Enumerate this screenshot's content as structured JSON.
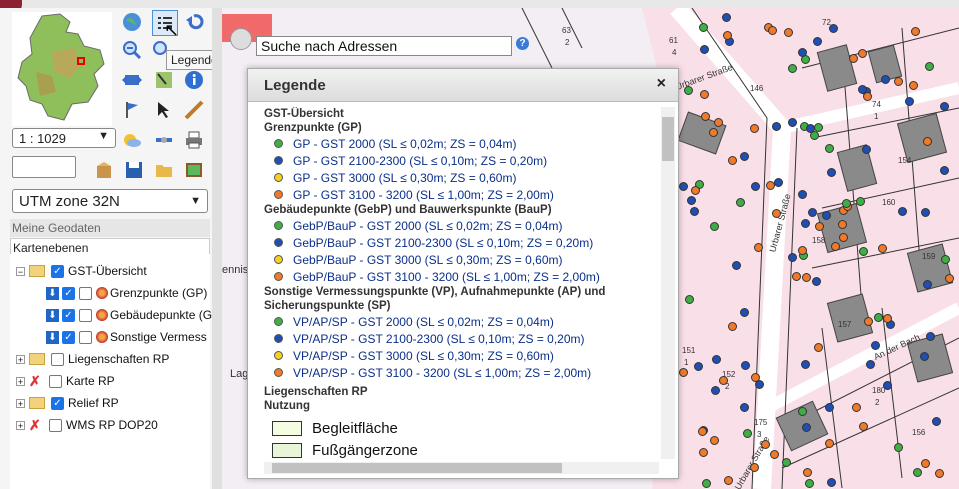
{
  "toolbar": {
    "tooltip": "Legende"
  },
  "scale": {
    "value": "1 : 1029"
  },
  "coordinate_input": {
    "value": ""
  },
  "crs": {
    "value": "UTM zone 32N"
  },
  "geodata": {
    "header": "Meine Geodaten",
    "subheader": "Kartenebenen"
  },
  "layers": [
    {
      "label": "GST-Übersicht"
    },
    {
      "label": "Grenzpunkte (GP)"
    },
    {
      "label": "Gebäudepunkte (G"
    },
    {
      "label": "Sonstige Vermess"
    },
    {
      "label": "Liegenschaften RP"
    },
    {
      "label": "Karte RP"
    },
    {
      "label": "Relief RP"
    },
    {
      "label": "WMS RP DOP20"
    }
  ],
  "search": {
    "value": "Suche nach Adressen"
  },
  "legend": {
    "title": "Legende",
    "close": "×",
    "section1": "GST-Übersicht",
    "gp_head": "Grenzpunkte (GP)",
    "gp": [
      "GP - GST 2000 (SL ≤ 0,02m; ZS = 0,04m)",
      "GP - GST 2100-2300 (SL ≤ 0,10m; ZS = 0,20m)",
      "GP - GST 3000 (SL ≤ 0,30m; ZS = 0,60m)",
      "GP - GST 3100 - 3200 (SL ≤ 1,00m; ZS = 2,00m)"
    ],
    "gebp_head": "Gebäudepunkte (GebP) und Bauwerkspunkte (BauP)",
    "gebp": [
      "GebP/BauP - GST 2000 (SL ≤ 0,02m; ZS = 0,04m)",
      "GebP/BauP - GST 2100-2300 (SL ≤ 0,10m; ZS = 0,20m)",
      "GebP/BauP - GST 3000 (SL ≤ 0,30m; ZS = 0,60m)",
      "GebP/BauP - GST 3100 - 3200 (SL ≤ 1,00m; ZS = 2,00m)"
    ],
    "vp_head": "Sonstige Vermessungspunkte (VP), Aufnahmepunkte (AP) und Sicherungspunkte (SP)",
    "vp": [
      "VP/AP/SP - GST 2000 (SL ≤ 0,02m; ZS = 0,04m)",
      "VP/AP/SP - GST 2100-2300 (SL ≤ 0,10m; ZS = 0,20m)",
      "VP/AP/SP - GST 3000 (SL ≤ 0,30m; ZS = 0,60m)",
      "VP/AP/SP - GST 3100 - 3200 (SL ≤ 1,00m; ZS = 2,00m)"
    ],
    "section2": "Liegenschaften RP",
    "nutzung_head": "Nutzung",
    "nutzung": [
      "Begleitfläche",
      "Fußgängerzone"
    ]
  },
  "map_labels": {
    "street1": "Urbarer Straße",
    "street2": "Urbarer Straße",
    "street3": "An der Bach",
    "street4": "Urbarer Straße",
    "partial1": "ennis",
    "partial2": "Lag",
    "parcels": [
      "63",
      "2",
      "72",
      "61",
      "4",
      "146",
      "74",
      "1",
      "154",
      "160",
      "158",
      "159",
      "157",
      "151",
      "1",
      "152",
      "2",
      "175",
      "3",
      "180",
      "2",
      "156"
    ]
  },
  "colors": {
    "gst2000": "#3cb043",
    "gst2100": "#1f4fb5",
    "gst3000": "#f2d21b",
    "gst3100": "#f07a2a",
    "begleit": "#f5fde0",
    "fuss": "#e8f5d8"
  }
}
